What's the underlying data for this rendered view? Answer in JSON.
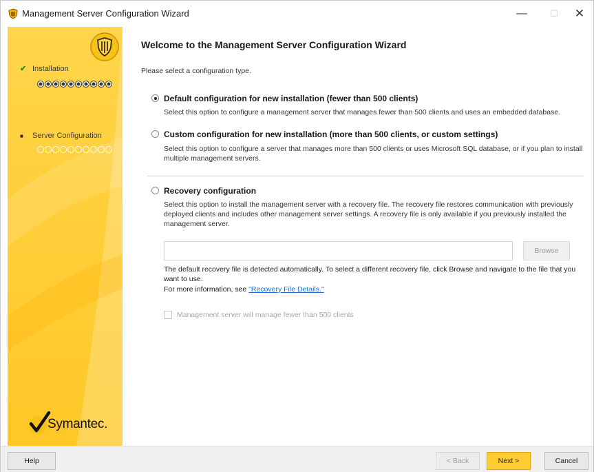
{
  "window": {
    "title": "Management Server Configuration Wizard",
    "accent_color": "#ffcc33"
  },
  "sidebar": {
    "steps": [
      {
        "label": "Installation",
        "status": "complete",
        "icon": "check-icon"
      },
      {
        "label": "Server Configuration",
        "status": "current",
        "icon": "bullet-icon"
      }
    ],
    "brand": "Symantec."
  },
  "main": {
    "heading": "Welcome to the Management Server Configuration Wizard",
    "prompt": "Please select a configuration type.",
    "options": [
      {
        "label": "Default configuration for new installation (fewer than 500 clients)",
        "description": "Select this option to configure a management server that manages fewer than 500 clients and uses an embedded database.",
        "selected": true
      },
      {
        "label": "Custom configuration for new installation  (more than 500 clients, or custom settings)",
        "description": "Select this option to configure a server that manages more than 500 clients or uses Microsoft SQL database, or if you plan to install multiple management servers.",
        "selected": false
      },
      {
        "label": "Recovery configuration",
        "description": "Select this option to install the management server with a recovery file. The recovery file restores communication with previously deployed clients and includes other management server settings. A recovery file is only available if you previously installed the management server.",
        "selected": false
      }
    ],
    "recovery_file": {
      "value": "",
      "browse_label": "Browse",
      "note": "The default recovery file is detected automatically. To select a different recovery file, click Browse and navigate to the file that you want to use.",
      "more_info_prefix": "For more information, see ",
      "more_info_link": "\"Recovery File Details.\""
    },
    "checkbox_label": "Management server will manage fewer than 500 clients"
  },
  "footer": {
    "help": "Help",
    "back": "< Back",
    "next": "Next >",
    "cancel": "Cancel"
  }
}
